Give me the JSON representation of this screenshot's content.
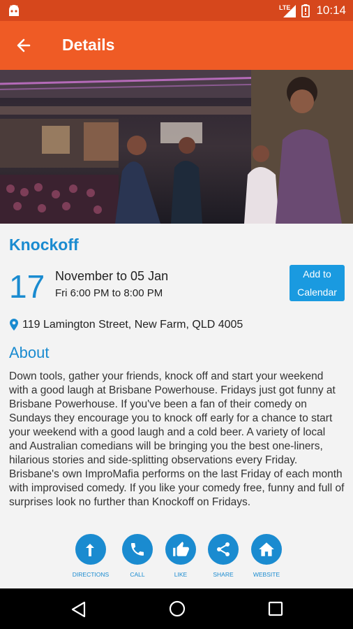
{
  "status_bar": {
    "time": "10:14",
    "network": "LTE"
  },
  "app_bar": {
    "title": "Details"
  },
  "event": {
    "title": "Knockoff",
    "day": "17",
    "date_range": "November to 05 Jan",
    "times": "Fri 6:00 PM to 8:00 PM",
    "calendar_button": "Add to Calendar",
    "address": "119 Lamington Street, New Farm, QLD 4005"
  },
  "about": {
    "heading": "About",
    "text": "Down tools, gather your friends, knock off and start your weekend with a good laugh at Brisbane Powerhouse. Fridays just got funny at Brisbane Powerhouse. If you've been a fan of their comedy on Sundays they encourage you to knock off early for a chance to start your weekend with a good laugh and a cold beer. A variety of local and Australian comedians will be bringing you the best one-liners, hilarious stories and side-splitting observations every Friday. Brisbane's own ImproMafia performs on the last Friday of each month with improvised comedy. If you like your comedy free, funny and full of surprises look no further than Knockoff on Fridays."
  },
  "actions": [
    {
      "label": "DIRECTIONS",
      "icon": "directions-icon"
    },
    {
      "label": "CALL",
      "icon": "phone-icon"
    },
    {
      "label": "LIKE",
      "icon": "thumbs-up-icon"
    },
    {
      "label": "SHARE",
      "icon": "share-icon"
    },
    {
      "label": "WEBSITE",
      "icon": "home-icon"
    }
  ],
  "colors": {
    "status_bar": "#d6471c",
    "app_bar": "#ef5b25",
    "accent": "#1a8bd0",
    "button": "#1a9ae0"
  }
}
